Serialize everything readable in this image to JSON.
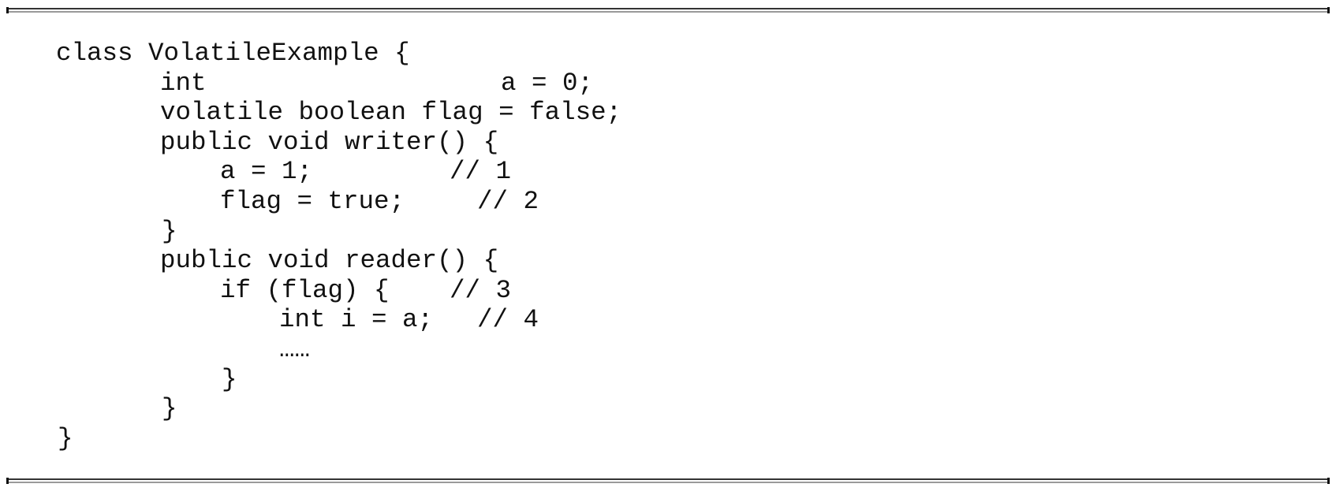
{
  "code": {
    "lines": [
      [
        {
          "text": "class VolatileExample {",
          "col": 0
        }
      ],
      [
        {
          "text": "int",
          "col": 1
        },
        {
          "text": "a = 0;",
          "col": 4
        }
      ],
      [
        {
          "text": "volatile boolean flag = false;",
          "col": 1
        }
      ],
      [
        {
          "text": "public void writer() {",
          "col": 1
        }
      ],
      [
        {
          "text": "a = 1;",
          "col": 2
        },
        {
          "text": "// 1",
          "col": 5
        }
      ],
      [
        {
          "text": "flag = true;",
          "col": 2
        },
        {
          "text": "// 2",
          "col": 6
        }
      ],
      [
        {
          "text": "}",
          "col": 1
        }
      ],
      [
        {
          "text": "public void reader() {",
          "col": 1
        }
      ],
      [
        {
          "text": "if (flag) {",
          "col": 2
        },
        {
          "text": "// 3",
          "col": 5
        }
      ],
      [
        {
          "text": "int i = a;",
          "col": 3
        },
        {
          "text": "// 4",
          "col": 6
        }
      ],
      [
        {
          "text": "……",
          "col": 3
        }
      ],
      [
        {
          "text": "}",
          "col": 2
        }
      ],
      [
        {
          "text": "}",
          "col": 1
        }
      ],
      [
        {
          "text": "}",
          "col": 0
        }
      ]
    ]
  }
}
